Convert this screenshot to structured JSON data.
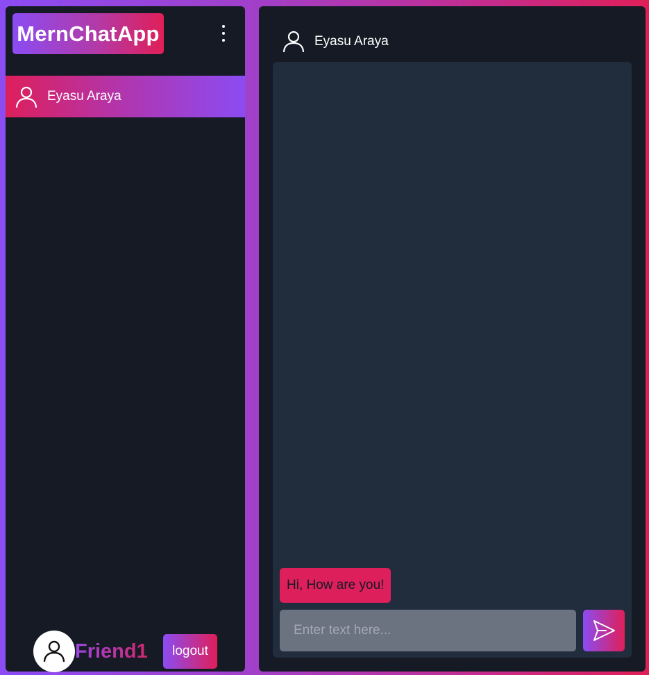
{
  "app": {
    "title": "MernChatApp"
  },
  "menu": {
    "icon": "kebab-menu-icon"
  },
  "sidebar": {
    "contacts": [
      {
        "name": "Eyasu Araya",
        "icon": "user-icon",
        "selected": true
      }
    ],
    "footer": {
      "avatar_icon": "user-icon",
      "username": "Friend1",
      "logout_label": "logout"
    }
  },
  "chat": {
    "header": {
      "name": "Eyasu Araya",
      "icon": "user-icon"
    },
    "messages": [
      {
        "text": "Hi, How are you!"
      }
    ],
    "composer": {
      "placeholder": "Enter text here...",
      "value": "",
      "send_icon": "send-icon"
    }
  },
  "colors": {
    "brand_purple": "#8b4cf3",
    "brand_pink": "#e01f58",
    "panel_bg": "#151a24",
    "messages_bg": "#212c3d",
    "input_bg": "#6b7280"
  }
}
